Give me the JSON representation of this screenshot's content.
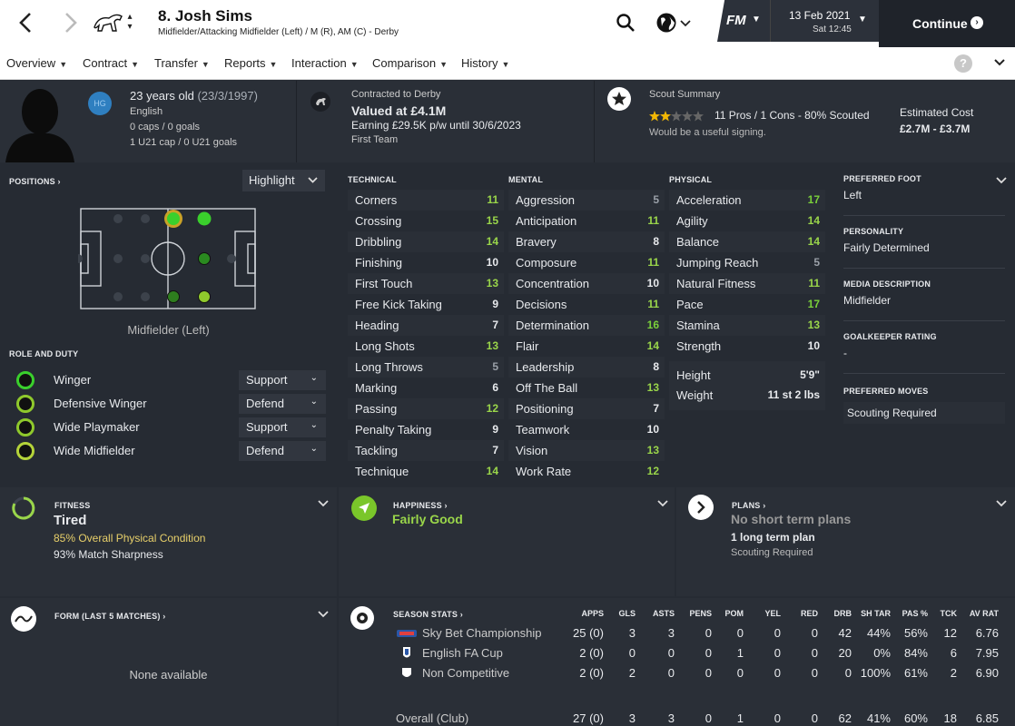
{
  "header": {
    "title": "8. Josh Sims",
    "subtitle": "Midfielder/Attacking Midfielder (Left) / M (R), AM (C) - Derby",
    "date": "13 Feb 2021",
    "time": "Sat 12:45",
    "fm_label": "FM",
    "continue_label": "Continue"
  },
  "nav": {
    "items": [
      "Overview",
      "Contract",
      "Transfer",
      "Reports",
      "Interaction",
      "Comparison",
      "History"
    ],
    "help": "?"
  },
  "profile": {
    "age": "23 years old",
    "dob": "(23/3/1997)",
    "nationality": "English",
    "nation_code": "HG",
    "caps": "0 caps / 0 goals",
    "u21caps": "1 U21 cap / 0 U21 goals"
  },
  "contract": {
    "club_line": "Contracted to Derby",
    "value": "Valued at £4.1M",
    "earning": "Earning £29.5K p/w until 30/6/2023",
    "squad": "First Team"
  },
  "scout": {
    "title": "Scout Summary",
    "stars": 2.5,
    "pros": "11 Pros / 1 Cons - 80% Scouted",
    "note": "Would be a useful signing.",
    "cost_label": "Estimated Cost",
    "cost": "£2.7M - £3.7M"
  },
  "positions": {
    "label": "POSITIONS",
    "dropdown": "Highlight",
    "caption": "Midfielder (Left)"
  },
  "roles": {
    "label": "ROLE AND DUTY",
    "items": [
      {
        "role": "Winger",
        "duty": "Support"
      },
      {
        "role": "Defensive Winger",
        "duty": "Defend"
      },
      {
        "role": "Wide Playmaker",
        "duty": "Support"
      },
      {
        "role": "Wide Midfielder",
        "duty": "Defend"
      }
    ]
  },
  "attributes": {
    "technical_label": "TECHNICAL",
    "mental_label": "MENTAL",
    "physical_label": "PHYSICAL",
    "technical": [
      {
        "name": "Corners",
        "value": "11"
      },
      {
        "name": "Crossing",
        "value": "15"
      },
      {
        "name": "Dribbling",
        "value": "14"
      },
      {
        "name": "Finishing",
        "value": "10"
      },
      {
        "name": "First Touch",
        "value": "13"
      },
      {
        "name": "Free Kick Taking",
        "value": "9"
      },
      {
        "name": "Heading",
        "value": "7"
      },
      {
        "name": "Long Shots",
        "value": "13"
      },
      {
        "name": "Long Throws",
        "value": "5"
      },
      {
        "name": "Marking",
        "value": "6"
      },
      {
        "name": "Passing",
        "value": "12"
      },
      {
        "name": "Penalty Taking",
        "value": "9"
      },
      {
        "name": "Tackling",
        "value": "7"
      },
      {
        "name": "Technique",
        "value": "14"
      }
    ],
    "mental": [
      {
        "name": "Aggression",
        "value": "5"
      },
      {
        "name": "Anticipation",
        "value": "11"
      },
      {
        "name": "Bravery",
        "value": "8"
      },
      {
        "name": "Composure",
        "value": "11"
      },
      {
        "name": "Concentration",
        "value": "10"
      },
      {
        "name": "Decisions",
        "value": "11"
      },
      {
        "name": "Determination",
        "value": "16"
      },
      {
        "name": "Flair",
        "value": "14"
      },
      {
        "name": "Leadership",
        "value": "8"
      },
      {
        "name": "Off The Ball",
        "value": "13"
      },
      {
        "name": "Positioning",
        "value": "7"
      },
      {
        "name": "Teamwork",
        "value": "10"
      },
      {
        "name": "Vision",
        "value": "13"
      },
      {
        "name": "Work Rate",
        "value": "12"
      }
    ],
    "physical": [
      {
        "name": "Acceleration",
        "value": "17"
      },
      {
        "name": "Agility",
        "value": "14"
      },
      {
        "name": "Balance",
        "value": "14"
      },
      {
        "name": "Jumping Reach",
        "value": "5"
      },
      {
        "name": "Natural Fitness",
        "value": "11"
      },
      {
        "name": "Pace",
        "value": "17"
      },
      {
        "name": "Stamina",
        "value": "13"
      },
      {
        "name": "Strength",
        "value": "10"
      }
    ],
    "height_label": "Height",
    "height": "5'9\"",
    "weight_label": "Weight",
    "weight": "11 st 2 lbs"
  },
  "info": {
    "foot_label": "PREFERRED FOOT",
    "foot": "Left",
    "personality_label": "PERSONALITY",
    "personality": "Fairly Determined",
    "media_label": "MEDIA DESCRIPTION",
    "media": "Midfielder",
    "gk_label": "GOALKEEPER RATING",
    "gk": "-",
    "moves_label": "PREFERRED MOVES",
    "moves": "Scouting Required"
  },
  "fitness": {
    "label": "FITNESS",
    "status": "Tired",
    "physical": "85% Overall Physical Condition",
    "sharpness": "93% Match Sharpness"
  },
  "happiness": {
    "label": "HAPPINESS",
    "status": "Fairly Good"
  },
  "plans": {
    "label": "PLANS",
    "short": "No short term plans",
    "long": "1 long term plan",
    "long_note": "Scouting Required"
  },
  "form": {
    "label": "FORM (LAST 5 MATCHES)",
    "empty": "None available"
  },
  "season_stats": {
    "label": "SEASON STATS",
    "headers": [
      "APPS",
      "GLS",
      "ASTS",
      "PENS",
      "POM",
      "YEL",
      "RED",
      "DRB",
      "SH TAR",
      "PAS %",
      "TCK",
      "AV RAT"
    ],
    "rows": [
      {
        "comp": "Sky Bet Championship",
        "values": [
          "25 (0)",
          "3",
          "3",
          "0",
          "0",
          "0",
          "0",
          "42",
          "44%",
          "56%",
          "12",
          "6.76"
        ]
      },
      {
        "comp": "English FA Cup",
        "values": [
          "2 (0)",
          "0",
          "0",
          "0",
          "1",
          "0",
          "0",
          "20",
          "0%",
          "84%",
          "6",
          "7.95"
        ]
      },
      {
        "comp": "Non Competitive",
        "values": [
          "2 (0)",
          "2",
          "0",
          "0",
          "0",
          "0",
          "0",
          "0",
          "100%",
          "61%",
          "2",
          "6.90"
        ]
      }
    ],
    "total": {
      "comp": "Overall (Club)",
      "values": [
        "27 (0)",
        "3",
        "3",
        "0",
        "1",
        "0",
        "0",
        "62",
        "41%",
        "60%",
        "18",
        "6.85"
      ]
    }
  },
  "colors": {
    "accent_green": "#7ad03a",
    "rating_star": "#f2b705",
    "bg": "#262b33"
  }
}
